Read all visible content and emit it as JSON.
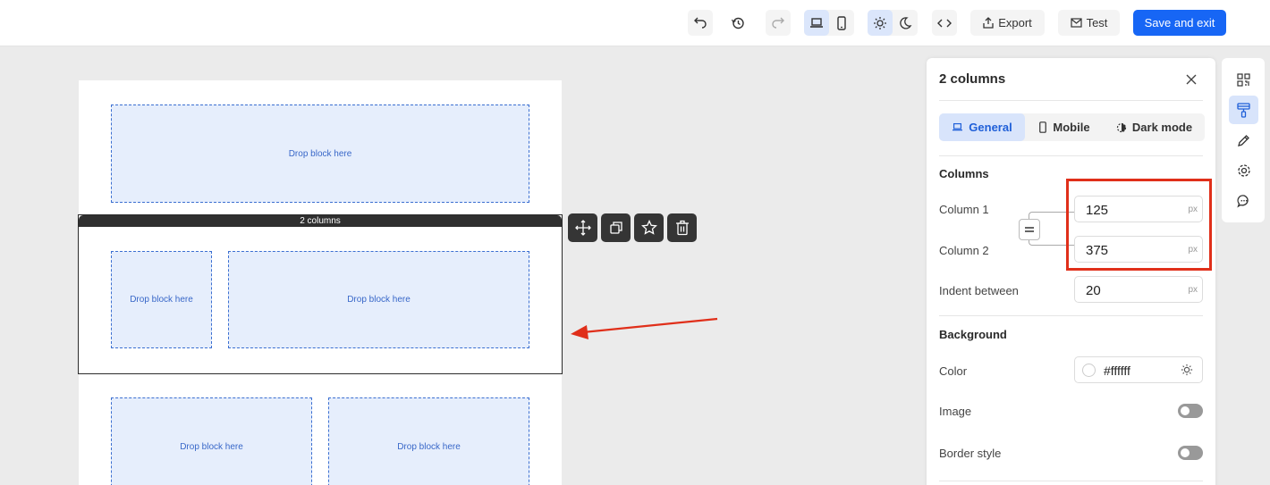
{
  "toolbar": {
    "export_label": "Export",
    "test_label": "Test",
    "save_label": "Save and exit"
  },
  "canvas": {
    "drop_text": "Drop block here",
    "selected_label": "2 columns"
  },
  "panel": {
    "title": "2 columns",
    "tabs": [
      {
        "label": "General"
      },
      {
        "label": "Mobile"
      },
      {
        "label": "Dark mode"
      }
    ],
    "columns": {
      "title": "Columns",
      "column1_label": "Column 1",
      "column1_value": "125",
      "column2_label": "Column 2",
      "column2_value": "375",
      "indent_label": "Indent between",
      "indent_value": "20",
      "unit": "px"
    },
    "background": {
      "title": "Background",
      "color_label": "Color",
      "color_value": "#ffffff",
      "image_label": "Image",
      "border_label": "Border style"
    }
  },
  "colors": {
    "accent": "#1766f5",
    "highlight": "#e02f1a",
    "drop_fill": "#e6eefc"
  }
}
